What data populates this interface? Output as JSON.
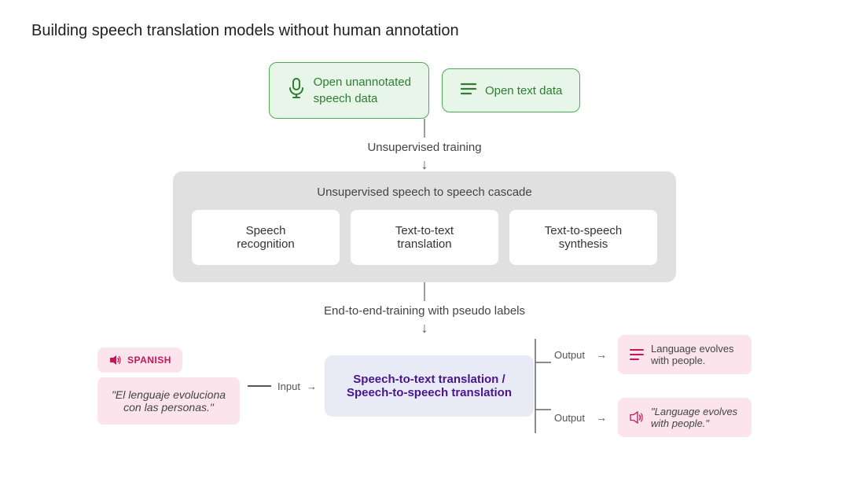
{
  "title": "Building speech translation models without human annotation",
  "top_boxes": [
    {
      "id": "speech-data",
      "icon": "🎙",
      "label": "Open unannotated\nspeech data",
      "icon_type": "microphone"
    },
    {
      "id": "text-data",
      "icon": "☰",
      "label": "Open text data",
      "icon_type": "lines"
    }
  ],
  "unsupervised_training_label": "Unsupervised training",
  "cascade_box": {
    "title": "Unsupervised speech to speech cascade",
    "items": [
      {
        "id": "speech-recognition",
        "label": "Speech\nrecognition"
      },
      {
        "id": "text-to-text",
        "label": "Text-to-text\ntranslation"
      },
      {
        "id": "text-to-speech",
        "label": "Text-to-speech\nsynthesis"
      }
    ]
  },
  "end_to_end_label": "End-to-end-training with pseudo labels",
  "input_label": "Input",
  "output_label_1": "Output",
  "output_label_2": "Output",
  "spanish_badge": "SPANISH",
  "spanish_text": "\"El lenguaje evoluciona\ncon las personas.\"",
  "translation_box": "Speech-to-text translation /\nSpeech-to-speech translation",
  "output_text": "Language evolves\nwith people.",
  "output_speech": "\"Language evolves\nwith people.\""
}
